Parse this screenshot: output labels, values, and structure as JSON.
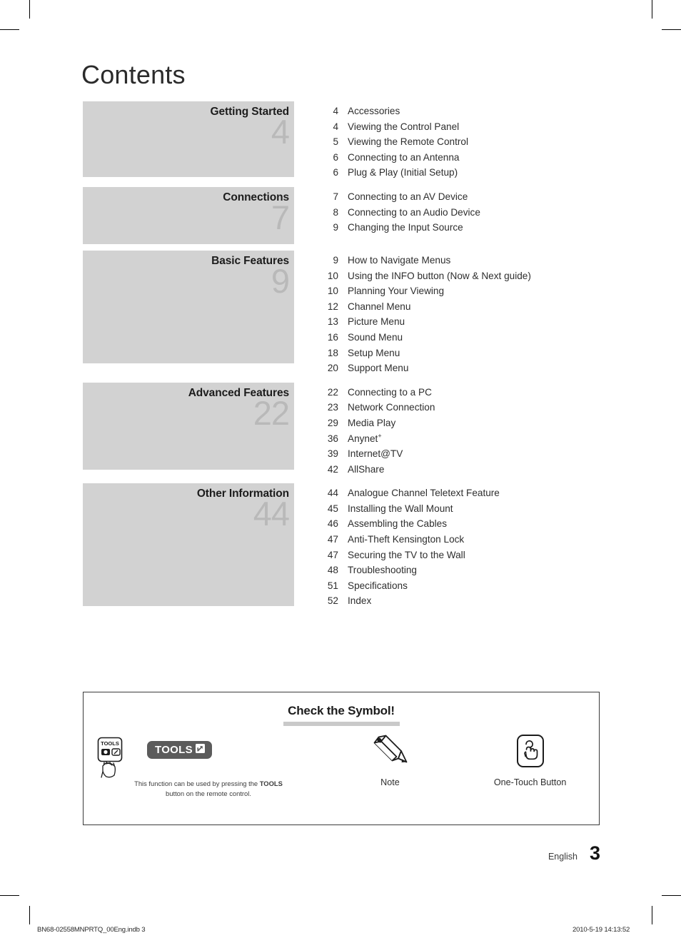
{
  "page": {
    "title": "Contents",
    "language": "English",
    "number": "3"
  },
  "toc": {
    "sections": [
      {
        "title": "Getting Started",
        "start_page": "4",
        "entries": [
          {
            "page": "4",
            "label": "Accessories"
          },
          {
            "page": "4",
            "label": "Viewing the Control Panel"
          },
          {
            "page": "5",
            "label": "Viewing the Remote Control"
          },
          {
            "page": "6",
            "label": "Connecting to an Antenna"
          },
          {
            "page": "6",
            "label": "Plug & Play (Initial Setup)"
          }
        ]
      },
      {
        "title": "Connections",
        "start_page": "7",
        "entries": [
          {
            "page": "7",
            "label": "Connecting to an AV Device"
          },
          {
            "page": "8",
            "label": "Connecting to an Audio Device"
          },
          {
            "page": "9",
            "label": "Changing the Input Source"
          }
        ]
      },
      {
        "title": "Basic Features",
        "start_page": "9",
        "entries": [
          {
            "page": "9",
            "label": "How to Navigate Menus"
          },
          {
            "page": "10",
            "label": "Using the INFO button (Now & Next guide)"
          },
          {
            "page": "10",
            "label": "Planning Your Viewing"
          },
          {
            "page": "12",
            "label": "Channel Menu"
          },
          {
            "page": "13",
            "label": "Picture Menu"
          },
          {
            "page": "16",
            "label": "Sound Menu"
          },
          {
            "page": "18",
            "label": "Setup Menu"
          },
          {
            "page": "20",
            "label": "Support Menu"
          }
        ]
      },
      {
        "title": "Advanced Features",
        "start_page": "22",
        "entries": [
          {
            "page": "22",
            "label": "Connecting to a PC"
          },
          {
            "page": "23",
            "label": "Network Connection"
          },
          {
            "page": "29",
            "label": "Media Play"
          },
          {
            "page": "36",
            "label": "Anynet",
            "sup": "+"
          },
          {
            "page": "39",
            "label": "Internet@TV"
          },
          {
            "page": "42",
            "label": "AllShare"
          }
        ]
      },
      {
        "title": "Other Information",
        "start_page": "44",
        "entries": [
          {
            "page": "44",
            "label": "Analogue Channel Teletext Feature"
          },
          {
            "page": "45",
            "label": "Installing the Wall Mount"
          },
          {
            "page": "46",
            "label": "Assembling the Cables"
          },
          {
            "page": "47",
            "label": "Anti-Theft Kensington Lock"
          },
          {
            "page": "47",
            "label": "Securing the TV to the Wall"
          },
          {
            "page": "48",
            "label": "Troubleshooting"
          },
          {
            "page": "51",
            "label": "Specifications"
          },
          {
            "page": "52",
            "label": "Index"
          }
        ]
      }
    ]
  },
  "symbol_box": {
    "heading": "Check the Symbol!",
    "tools": {
      "remote_key_label": "TOOLS",
      "badge_label": "TOOLS",
      "caption_line1": "This function can be used by",
      "caption_bold": "TOOLS",
      "caption_line2_pre": "pressing the ",
      "caption_line2_post": " button on the",
      "caption_line3": "remote control."
    },
    "note": {
      "caption": "Note"
    },
    "one_touch": {
      "caption": "One-Touch Button"
    }
  },
  "footer": {
    "file": "BN68-02558MNPRTQ_00Eng.indb   3",
    "timestamp": "2010-5-19   14:13:52"
  },
  "colors": {
    "section_block": "#d2d2d2",
    "section_number": "#b9b9b9",
    "badge": "#5b5b5b",
    "underline": "#c9c9c9"
  }
}
